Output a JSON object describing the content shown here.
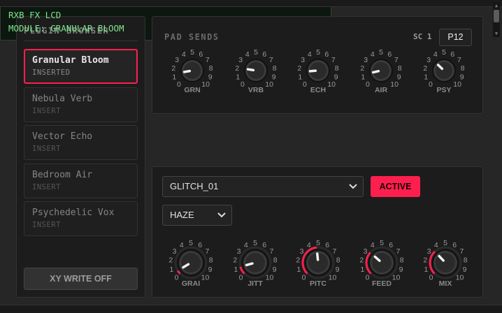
{
  "browser": {
    "title": "PLUGIN BROWSER",
    "items": [
      {
        "name": "Granular Bloom",
        "status": "INSERTED",
        "selected": true
      },
      {
        "name": "Nebula Verb",
        "status": "INSERT",
        "selected": false
      },
      {
        "name": "Vector Echo",
        "status": "INSERT",
        "selected": false
      },
      {
        "name": "Bedroom Air",
        "status": "INSERT",
        "selected": false
      },
      {
        "name": "Psychedelic Vox",
        "status": "INSERT",
        "selected": false
      }
    ],
    "xy_button": "XY WRITE OFF"
  },
  "sends": {
    "title": "PAD SENDS",
    "sc_label": "SC 1",
    "pad_button": "P12",
    "knobs": [
      {
        "label": "GRN",
        "value": 1.3
      },
      {
        "label": "VRB",
        "value": 2.0
      },
      {
        "label": "ECH",
        "value": 1.5
      },
      {
        "label": "AIR",
        "value": 1.2
      },
      {
        "label": "PSY",
        "value": 3.3
      }
    ]
  },
  "lcd": {
    "line1": "RXB FX LCD",
    "line2": "MODULE: GRANULAR BLOOM"
  },
  "module": {
    "preset_select": "GLITCH_01",
    "active_button": "ACTIVE",
    "mode_select": "HAZE",
    "knobs": [
      {
        "label": "GRAI",
        "value": 0.5
      },
      {
        "label": "JITT",
        "value": 1.1
      },
      {
        "label": "PITC",
        "value": 4.8
      },
      {
        "label": "FEED",
        "value": 3.2
      },
      {
        "label": "MIX",
        "value": 3.4
      }
    ]
  },
  "scale_ticks": [
    "0",
    "1",
    "2",
    "3",
    "4",
    "5",
    "6",
    "7",
    "8",
    "9",
    "10"
  ],
  "colors": {
    "accent": "#ff1f4e",
    "lcd_text": "#7fe58e",
    "panel": "#1c1c1c"
  }
}
